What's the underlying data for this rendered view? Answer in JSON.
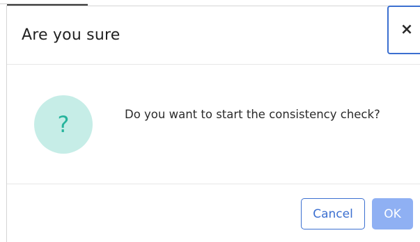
{
  "dialog": {
    "title": "Are you sure",
    "close_icon": "close-icon",
    "close_glyph": "×",
    "icon": "question-icon",
    "icon_glyph": "?",
    "message": "Do you want to start the consistency check?",
    "buttons": {
      "cancel_label": "Cancel",
      "ok_label": "OK"
    }
  },
  "colors": {
    "accent": "#3b6fd0",
    "ok_button_bg": "#8fb0f3",
    "icon_circle_bg": "#c6ede7",
    "icon_glyph": "#27b49c"
  }
}
